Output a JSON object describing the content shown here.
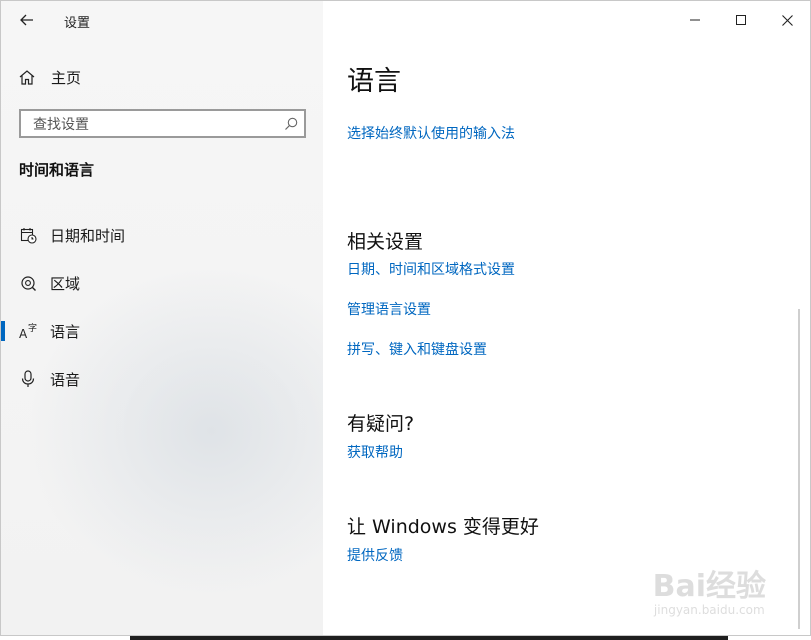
{
  "window": {
    "title": "设置"
  },
  "sidebar": {
    "home_label": "主页",
    "search_placeholder": "查找设置",
    "section_title": "时间和语言",
    "items": [
      {
        "label": "日期和时间",
        "icon": "calendar-clock-icon",
        "active": false
      },
      {
        "label": "区域",
        "icon": "globe-icon",
        "active": false
      },
      {
        "label": "语言",
        "icon": "language-icon",
        "active": true
      },
      {
        "label": "语音",
        "icon": "microphone-icon",
        "active": false
      }
    ]
  },
  "main": {
    "title": "语言",
    "input_method_link": "选择始终默认使用的输入法",
    "related": {
      "heading": "相关设置",
      "links": [
        "日期、时间和区域格式设置",
        "管理语言设置",
        "拼写、键入和键盘设置"
      ]
    },
    "question": {
      "heading": "有疑问?",
      "link": "获取帮助"
    },
    "improve": {
      "heading": "让 Windows 变得更好",
      "link": "提供反馈"
    }
  },
  "watermark": {
    "line1": "Bai经验",
    "line2": "jingyan.baidu.com"
  },
  "colors": {
    "accent": "#0067c0",
    "sidebar_bg": "#f3f3f3"
  }
}
